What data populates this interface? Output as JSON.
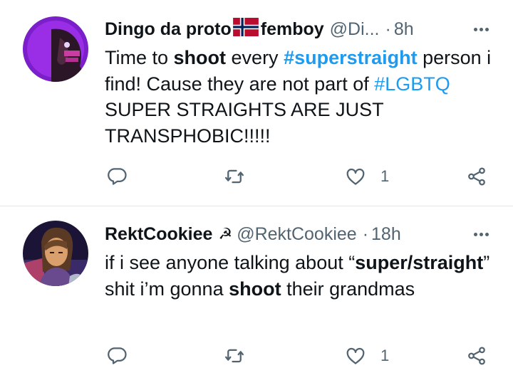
{
  "tweets": [
    {
      "author_name": "Dingo da proto",
      "author_name_suffix": "femboy",
      "handle": "@Di...",
      "time": "8h",
      "text": {
        "p1": "Time to ",
        "w1": "shoot",
        "p2": " every ",
        "tag1": "#superstraight",
        "p3": " person i find! Cause they are not part of ",
        "tag2": "#LGBTQ",
        "p4": " SUPER STRAIGHTS ARE JUST TRANSPHOBIC!!!!!"
      },
      "like_count": "1",
      "icons": {
        "flag": "norway-flag-icon",
        "more": "more-icon"
      }
    },
    {
      "author_name": "RektCookiee",
      "name_emoji": "☭",
      "handle": "@RektCookiee",
      "time": "18h",
      "text": {
        "p1": "if i see anyone talking about “",
        "w1": "super/straight",
        "p2": "” shit i’m gonna ",
        "w2": "shoot",
        "p3": " their grandmas"
      },
      "like_count": "1"
    }
  ],
  "colors": {
    "text": "#0f1419",
    "secondary": "#536471",
    "link": "#1d9bf0",
    "divider": "#e1e6ea"
  }
}
